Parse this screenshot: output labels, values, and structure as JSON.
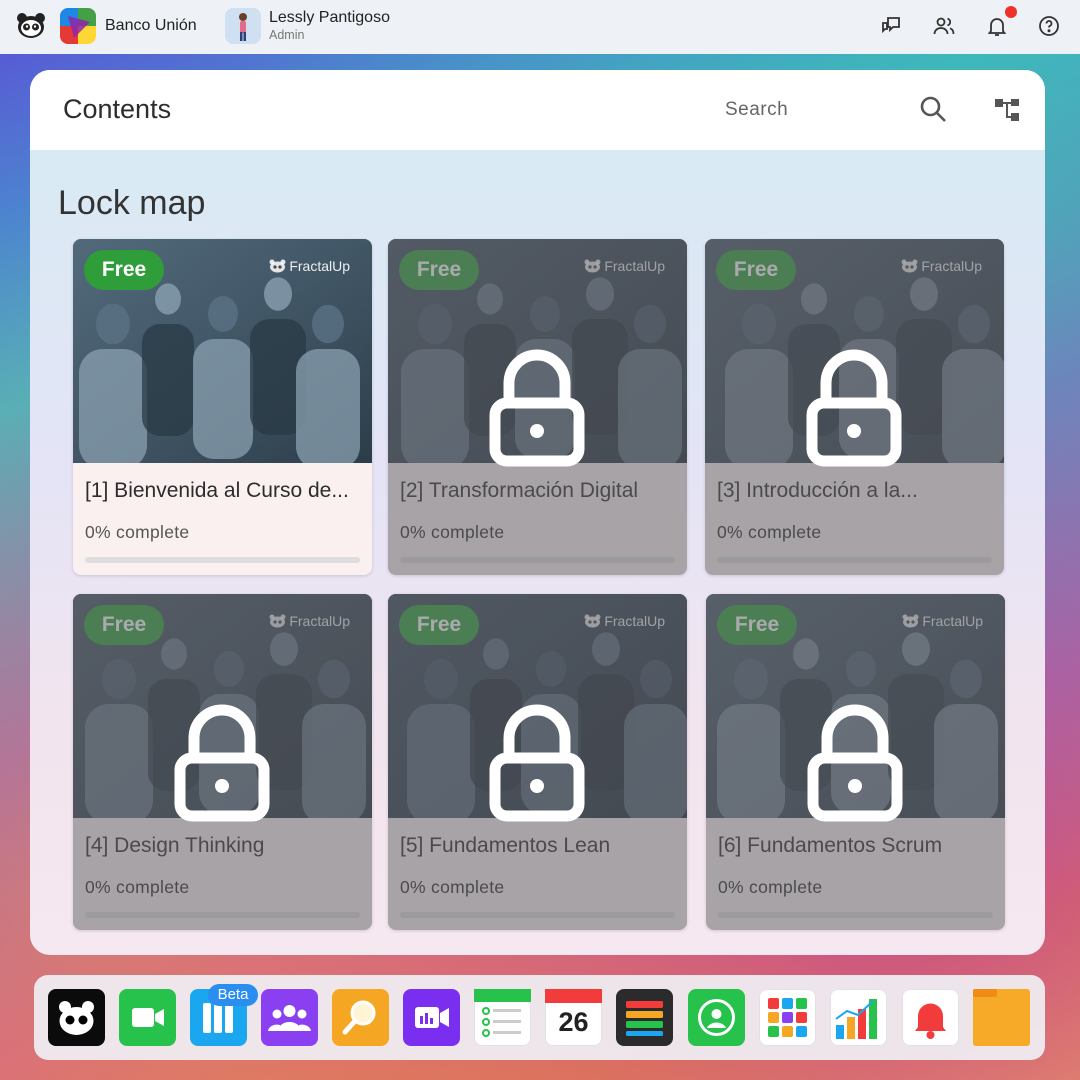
{
  "topbar": {
    "org_name": "Banco Unión",
    "user_name": "Lessly Pantigoso",
    "user_role": "Admin",
    "notifications_unread": true
  },
  "panel": {
    "title": "Contents",
    "search_label": "Search",
    "section_title": "Lock map"
  },
  "cards": [
    {
      "title": "[1] Bienvenida al Curso de...",
      "badge": "Free",
      "progress_label": "0% complete",
      "progress": 0,
      "locked": false,
      "brand": "FractalUp"
    },
    {
      "title": "[2] Transformación Digital",
      "badge": "Free",
      "progress_label": "0% complete",
      "progress": 0,
      "locked": true,
      "brand": "FractalUp"
    },
    {
      "title": "[3] Introducción a la...",
      "badge": "Free",
      "progress_label": "0% complete",
      "progress": 0,
      "locked": true,
      "brand": "FractalUp"
    },
    {
      "title": "[4] Design Thinking",
      "badge": "Free",
      "progress_label": "0% complete",
      "progress": 0,
      "locked": true,
      "brand": "FractalUp"
    },
    {
      "title": "[5] Fundamentos Lean",
      "badge": "Free",
      "progress_label": "0% complete",
      "progress": 0,
      "locked": true,
      "brand": "FractalUp"
    },
    {
      "title": "[6] Fundamentos Scrum",
      "badge": "Free",
      "progress_label": "0% complete",
      "progress": 0,
      "locked": true,
      "brand": "FractalUp"
    }
  ],
  "dock": {
    "beta_label": "Beta",
    "calendar_day": "26",
    "apps": [
      "panda-app-icon",
      "video-call-icon",
      "library-icon",
      "community-icon",
      "search-lens-icon",
      "video-meeting-icon",
      "checklist-icon",
      "calendar-icon",
      "data-stack-icon",
      "profile-chat-icon",
      "apps-grid-icon",
      "bar-chart-icon",
      "bell-app-icon",
      "folder-icon"
    ]
  },
  "colors": {
    "free_badge": "#2f9e3a",
    "notification_dot": "#f0302a",
    "beta_badge": "#2a8df0"
  }
}
